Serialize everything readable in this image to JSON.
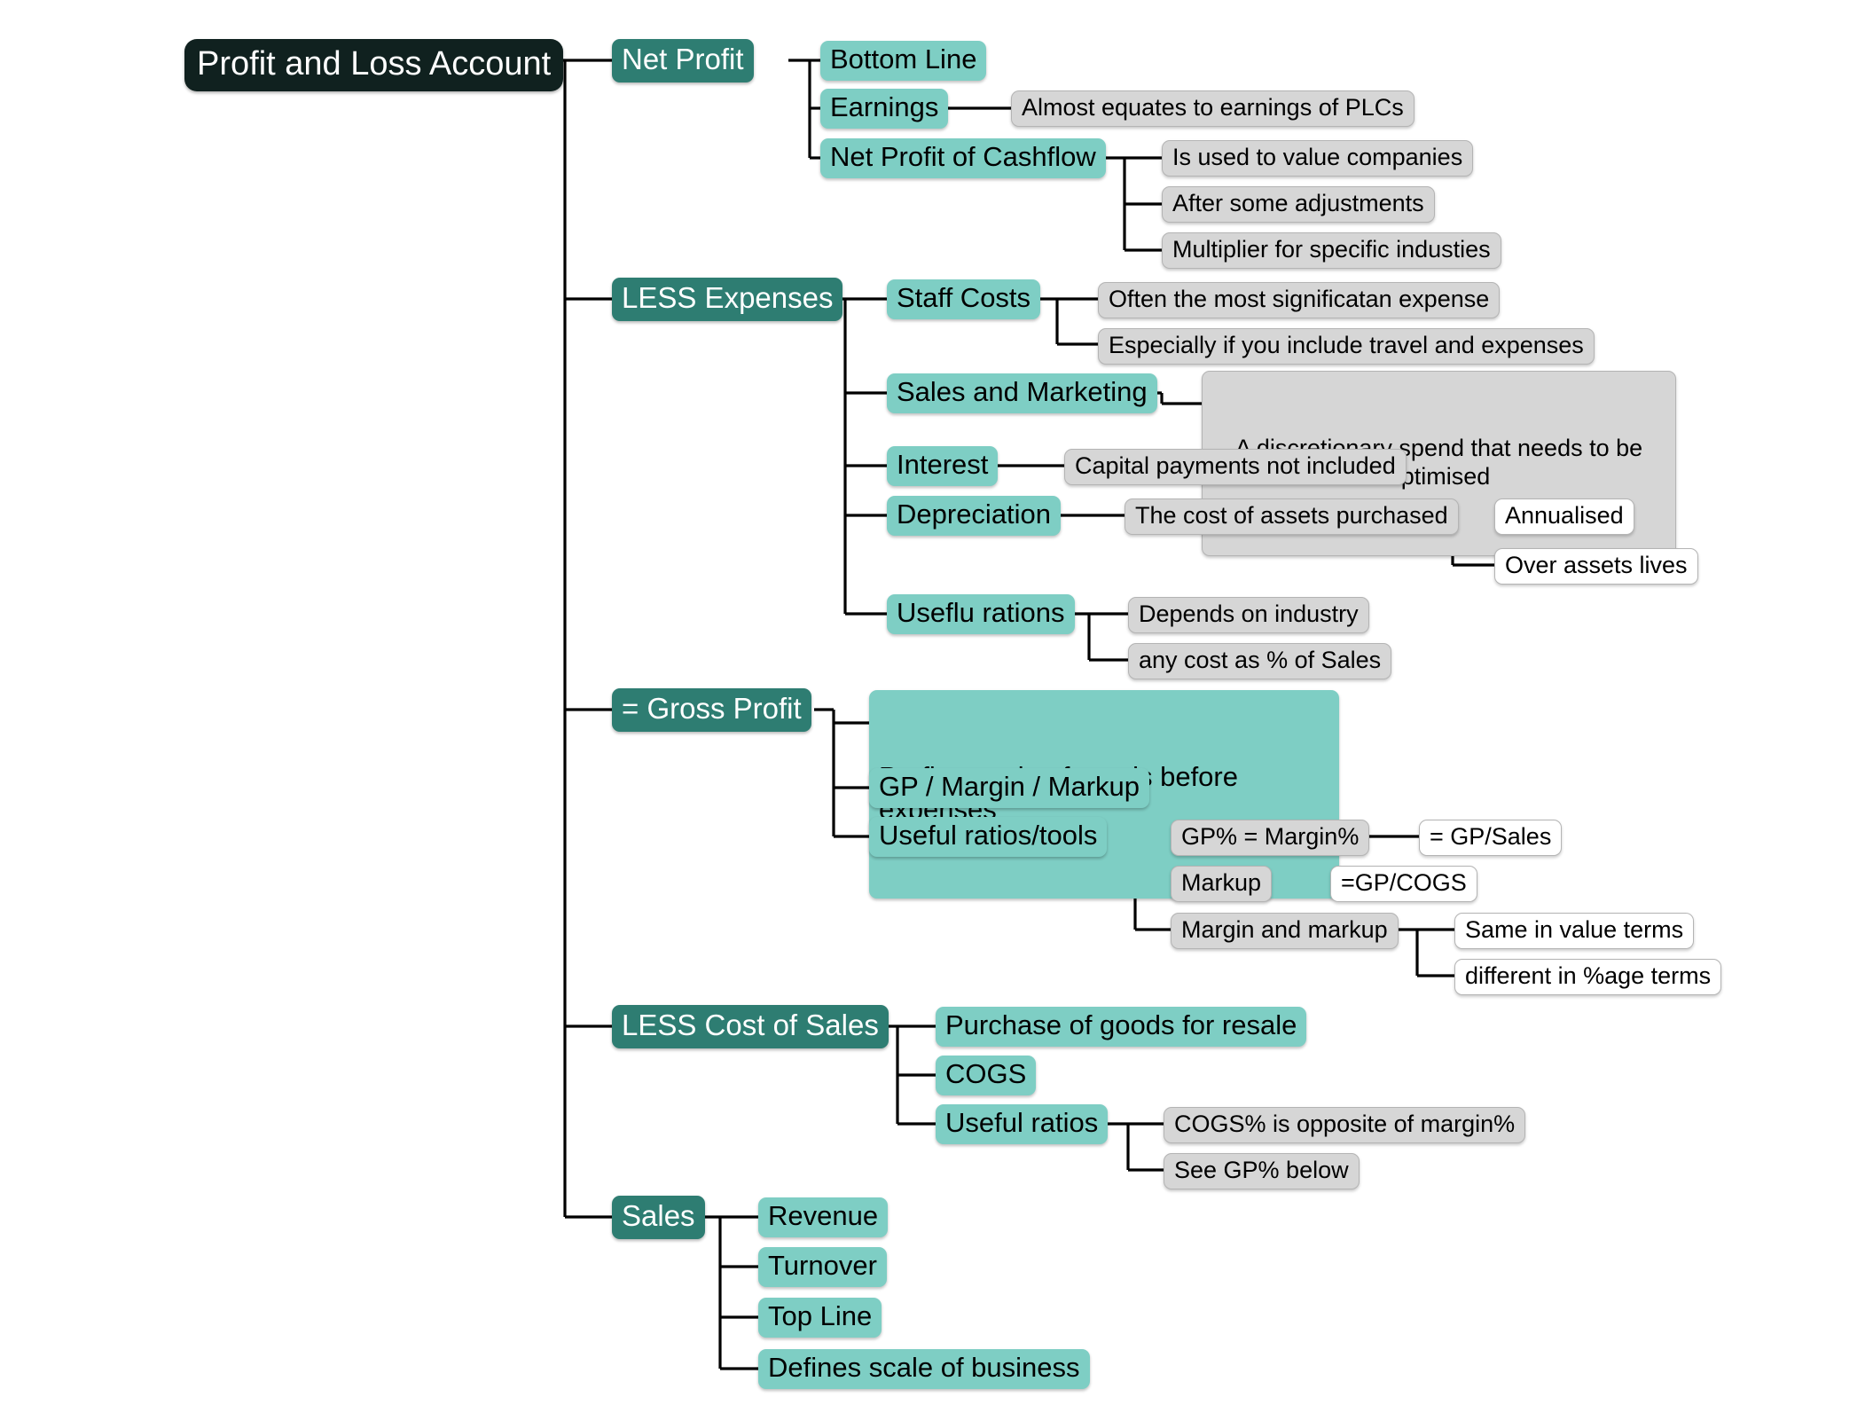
{
  "diagram": {
    "type": "mind-map",
    "title": "Profit and Loss Account",
    "palette": {
      "root_fill": "#10211f",
      "level1_fill": "#2e7d72",
      "level2_fill": "#7ecec4",
      "level3_fill": "#d6d6d6",
      "level4_fill": "#ffffff",
      "border_gray": "#b4b4b4",
      "link_color": "#000000",
      "background": "#ffffff"
    }
  },
  "root": {
    "label": "Profit and Loss Account"
  },
  "branches": [
    {
      "label": "Net Profit",
      "children": [
        {
          "label": "Bottom Line",
          "children": []
        },
        {
          "label": "Earnings",
          "children": [
            {
              "label": "Almost equates to earnings of PLCs",
              "children": []
            }
          ]
        },
        {
          "label": "Net Profit of Cashflow",
          "children": [
            {
              "label": "Is used to value companies",
              "children": []
            },
            {
              "label": "After some adjustments",
              "children": []
            },
            {
              "label": "Multiplier for specific industies",
              "children": []
            }
          ]
        }
      ]
    },
    {
      "label": "LESS Expenses",
      "children": [
        {
          "label": "Staff Costs",
          "children": [
            {
              "label": "Often the most significatan expense",
              "children": []
            },
            {
              "label": "Especially if you include travel and expenses",
              "children": []
            }
          ]
        },
        {
          "label": "Sales and Marketing",
          "children": [
            {
              "label": "A discretionary spend that needs to be optimised",
              "children": []
            }
          ]
        },
        {
          "label": "Interest",
          "children": [
            {
              "label": "Capital payments not included",
              "children": []
            }
          ]
        },
        {
          "label": "Depreciation",
          "children": [
            {
              "label": "The cost of assets purchased",
              "children": [
                {
                  "label": "Annualised"
                },
                {
                  "label": "Over assets lives"
                }
              ]
            }
          ]
        },
        {
          "label": "Useflu rations",
          "children": [
            {
              "label": "Depends on industry",
              "children": []
            },
            {
              "label": "any cost as % of Sales",
              "children": []
            }
          ]
        }
      ]
    },
    {
      "label": "= Gross Profit",
      "children": [
        {
          "label": "Profit on sale of goods before expenses",
          "children": []
        },
        {
          "label": "GP / Margin / Markup",
          "children": []
        },
        {
          "label": "Useful ratios/tools",
          "children": [
            {
              "label": "GP% = Margin%",
              "children": [
                {
                  "label": "= GP/Sales"
                }
              ]
            },
            {
              "label": "Markup",
              "children": [
                {
                  "label": "=GP/COGS"
                }
              ]
            },
            {
              "label": "Margin and markup",
              "children": [
                {
                  "label": "Same in value terms"
                },
                {
                  "label": "different in %age terms"
                }
              ]
            }
          ]
        }
      ]
    },
    {
      "label": "LESS Cost of Sales",
      "children": [
        {
          "label": "Purchase of goods for resale",
          "children": []
        },
        {
          "label": "COGS",
          "children": []
        },
        {
          "label": "Useful ratios",
          "children": [
            {
              "label": "COGS% is opposite of margin%",
              "children": []
            },
            {
              "label": "See GP% below",
              "children": []
            }
          ]
        }
      ]
    },
    {
      "label": "Sales",
      "children": [
        {
          "label": "Revenue",
          "children": []
        },
        {
          "label": "Turnover",
          "children": []
        },
        {
          "label": "Top Line",
          "children": []
        },
        {
          "label": "Defines scale of business",
          "children": []
        }
      ]
    }
  ],
  "nodes": {
    "root": "Profit and Loss Account",
    "net_profit": "Net Profit",
    "bottom_line": "Bottom Line",
    "earnings": "Earnings",
    "almost_equates": "Almost equates to earnings of PLCs",
    "npc": "Net Profit of Cashflow",
    "value_companies": "Is used to value companies",
    "after_adjustments": "After some adjustments",
    "multiplier": "Multiplier for specific industies",
    "less_expenses": "LESS Expenses",
    "staff_costs": "Staff Costs",
    "often_significant": "Often the most significatan expense",
    "especially_travel": "Especially if you include travel and expenses",
    "sales_marketing": "Sales and Marketing",
    "discretionary": "A discretionary spend that needs to be optimised",
    "interest": "Interest",
    "capital_payments": "Capital payments not included",
    "depreciation": "Depreciation",
    "cost_assets": "The cost of assets purchased",
    "annualised": "Annualised",
    "over_assets": "Over assets lives",
    "useflu_rations": "Useflu rations",
    "depends_industry": "Depends on industry",
    "any_cost": "any cost as % of Sales",
    "gross_profit": "= Gross Profit",
    "profit_on_sale": "Profit on sale of goods before expenses",
    "gp_margin_markup": "GP / Margin / Markup",
    "useful_ratios_tools": "Useful ratios/tools",
    "gp_margin_pct": "GP% = Margin%",
    "gp_over_sales": "= GP/Sales",
    "markup": "Markup",
    "gp_over_cogs": "=GP/COGS",
    "margin_and_markup": "Margin and markup",
    "same_value": "Same in value terms",
    "different_pct": "different in %age terms",
    "less_cost_sales": "LESS Cost of Sales",
    "purchase_goods": "Purchase of goods for resale",
    "cogs": "COGS",
    "useful_ratios": "Useful ratios",
    "cogs_opposite": "COGS% is opposite of margin%",
    "see_gp_below": "See GP% below",
    "sales": "Sales",
    "revenue": "Revenue",
    "turnover": "Turnover",
    "top_line": "Top Line",
    "defines_scale": "Defines scale of business"
  }
}
